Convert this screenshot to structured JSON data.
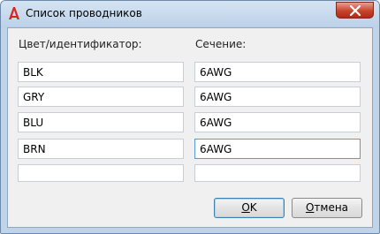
{
  "window": {
    "title": "Список проводников",
    "app_icon": "autocad-a-icon",
    "close_icon": "close-icon",
    "accent_red": "#c7432b"
  },
  "columns": {
    "id_label": "Цвет/идентификатор:",
    "section_label": "Сечение:"
  },
  "rows": [
    {
      "id": "BLK",
      "section": "6AWG"
    },
    {
      "id": "GRY",
      "section": "6AWG"
    },
    {
      "id": "BLU",
      "section": "6AWG"
    },
    {
      "id": "BRN",
      "section": "6AWG"
    },
    {
      "id": "",
      "section": ""
    }
  ],
  "buttons": {
    "ok_accel": "O",
    "ok_rest": "K",
    "cancel_accel": "О",
    "cancel_rest": "тмена"
  }
}
